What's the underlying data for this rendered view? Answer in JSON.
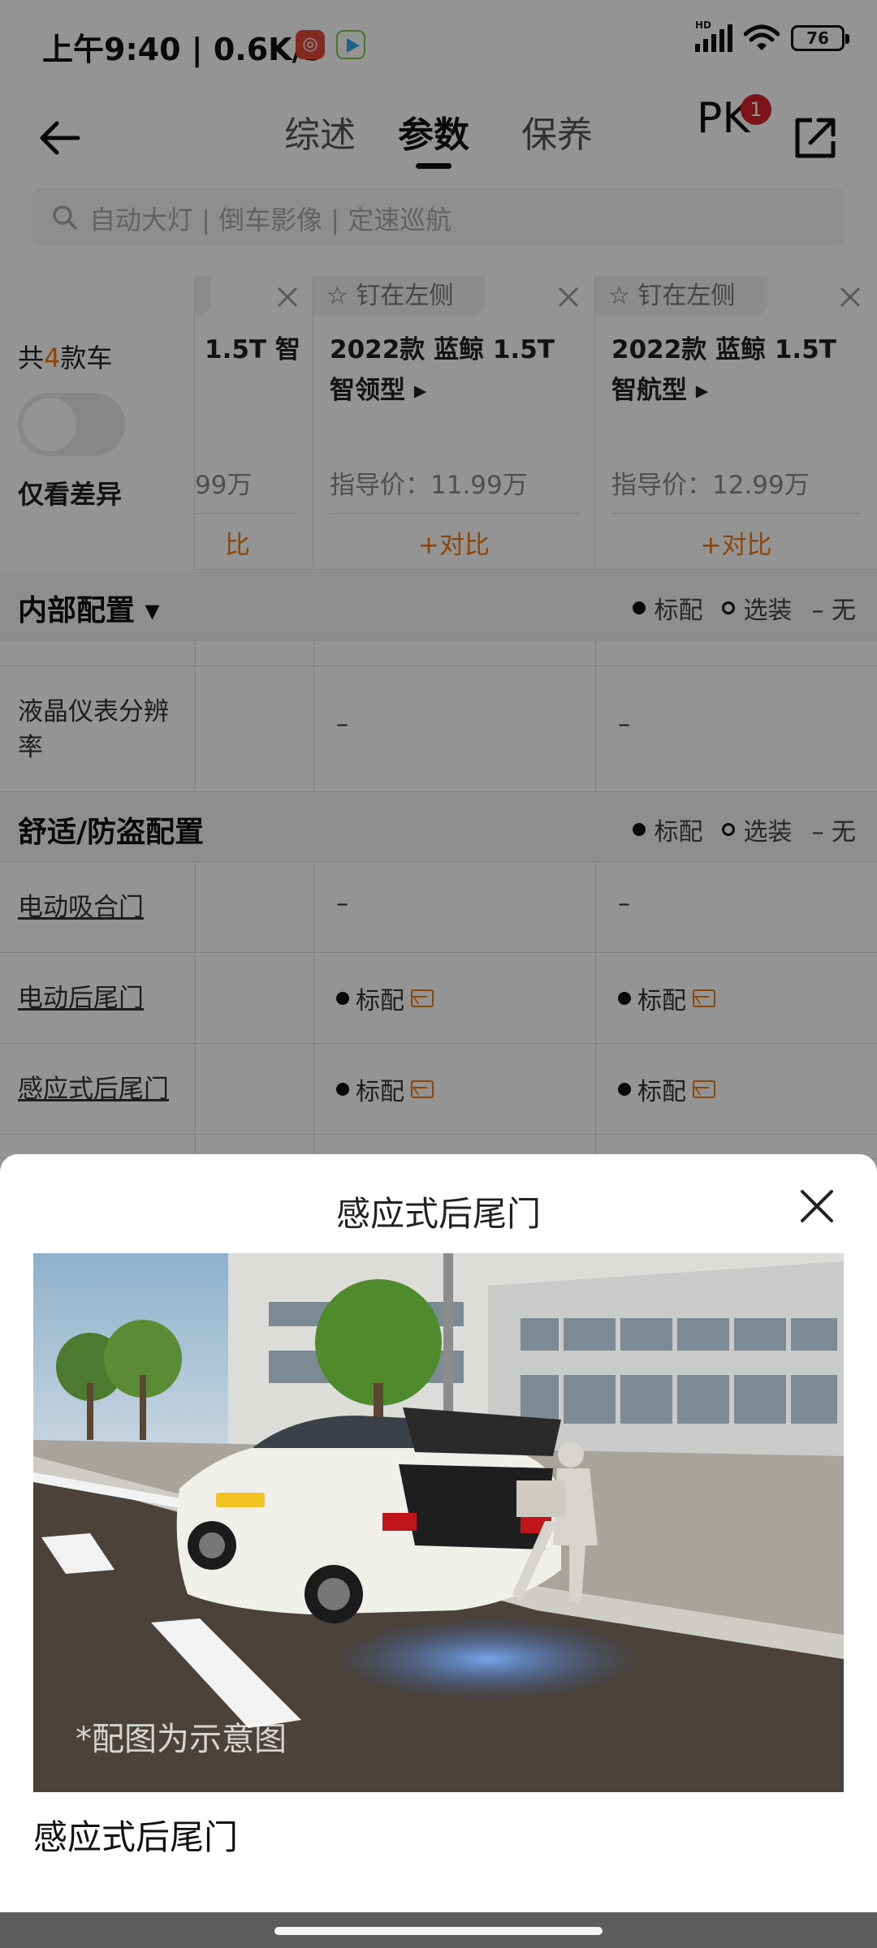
{
  "status": {
    "time": "上午9:40 | 0.6K/s",
    "battery": "76",
    "hd": "HD"
  },
  "nav": {
    "tabs": [
      "综述",
      "参数",
      "保养"
    ],
    "active_tab": "参数",
    "pk": "PK",
    "pk_badge": "1"
  },
  "search": {
    "placeholder": "自动大灯 | 倒车影像 | 定速巡航"
  },
  "compare_header": {
    "total_prefix": "共",
    "total_count": "4",
    "total_suffix": "款车",
    "diff_only": "仅看差异",
    "partial_card": {
      "name": "1.5T 智",
      "price": "99万",
      "compare": "比"
    },
    "cards": [
      {
        "pin": "钉在左侧",
        "name": "2022款 蓝鲸 1.5T 智领型 ▸",
        "price": "指导价：11.99万",
        "compare": "+对比"
      },
      {
        "pin": "钉在左侧",
        "name": "2022款 蓝鲸 1.5T 智航型 ▸",
        "price": "指导价：12.99万",
        "compare": "+对比"
      }
    ]
  },
  "legend": {
    "std": "标配",
    "opt": "选装",
    "none": "– 无"
  },
  "sections": [
    {
      "title": "内部配置 ▾"
    },
    {
      "title": "舒适/防盗配置"
    }
  ],
  "rows": [
    {
      "label": "液晶仪表分辨率",
      "v1": "–",
      "v2": "–"
    },
    {
      "label": "电动吸合门",
      "v1": "–",
      "v2": "–"
    },
    {
      "label": "电动后尾门",
      "v1": "标配",
      "v2": "标配"
    },
    {
      "label": "感应式后尾门",
      "v1": "标配",
      "v2": "标配"
    }
  ],
  "sheet": {
    "title": "感应式后尾门",
    "caption": "*配图为示意图",
    "subtitle": "感应式后尾门"
  },
  "colors": {
    "accent": "#f07a10",
    "badge": "#d6242b"
  }
}
